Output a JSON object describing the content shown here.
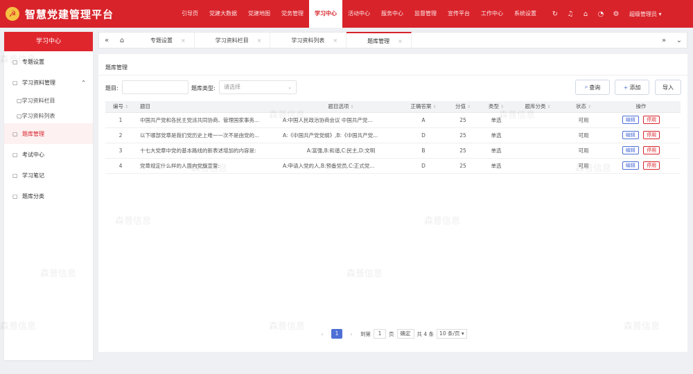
{
  "header": {
    "logo_glyph": "☭",
    "title": "智慧党建管理平台",
    "nav": [
      "引导页",
      "党建大数据",
      "党建地图",
      "党务管理",
      "学习中心",
      "活动中心",
      "服务中心",
      "监督管理",
      "宣传平台",
      "工作中心",
      "系统设置"
    ],
    "active_nav": "学习中心",
    "user": "超级管理员",
    "icons": [
      "refresh-icon",
      "bell-icon",
      "home-icon",
      "lock-icon",
      "settings-icon"
    ]
  },
  "sidebar": {
    "title": "学习中心",
    "items": [
      {
        "label": "专题设置"
      },
      {
        "label": "学习资料管理"
      },
      {
        "label": "学习资料栏目"
      },
      {
        "label": "学习资料列表"
      },
      {
        "label": "题库管理"
      },
      {
        "label": "考试中心"
      },
      {
        "label": "学习笔记"
      },
      {
        "label": "题库分类"
      }
    ]
  },
  "tabs": [
    {
      "label": "专题设置"
    },
    {
      "label": "学习资料栏目"
    },
    {
      "label": "学习资料列表"
    },
    {
      "label": "题库管理"
    }
  ],
  "panel": {
    "page_title": "题库管理",
    "filter": {
      "title_label": "题目:",
      "type_label": "题库类型:",
      "type_placeholder": "请选择"
    },
    "buttons": {
      "search": "查询",
      "add": "添加",
      "import": "导入"
    }
  },
  "table": {
    "columns": [
      "编号",
      "题目",
      "题目选项",
      "正确答案",
      "分值",
      "类型",
      "题库分类",
      "状态",
      "操作"
    ],
    "rows": [
      {
        "id": "1",
        "title": "中国共产党和各民主党派共同协商、管理国家事务...",
        "options": "A:中国人民政治协商会议 中国共产党...",
        "answer": "A",
        "score": "25",
        "type": "单选",
        "category": "",
        "status": "可用"
      },
      {
        "id": "2",
        "title": "以下哪部党章是我们党历史上唯一一次不是由党的...",
        "options": "A:《中国共产党党纲》,B:《中国共产党...",
        "answer": "D",
        "score": "25",
        "type": "单选",
        "category": "",
        "status": "可用"
      },
      {
        "id": "3",
        "title": "十七大党章中党的基本路线的新表述增加的内容是:",
        "options": "A:富强,B:和谐,C:民主,D:文明",
        "answer": "B",
        "score": "25",
        "type": "单选",
        "category": "",
        "status": "可用"
      },
      {
        "id": "4",
        "title": "党章规定什么样的人面向党旗宣誓:",
        "options": "A:申请入党的人,B:预备党员,C:正式党...",
        "answer": "D",
        "score": "25",
        "type": "单选",
        "category": "",
        "status": "可用"
      }
    ],
    "op_edit": "编辑",
    "op_delete": "停用"
  },
  "pager": {
    "current": "1",
    "goto_label": "到第",
    "goto_value": "1",
    "page_unit": "页",
    "confirm": "确定",
    "total": "共 4 条",
    "page_size": "10 条/页"
  },
  "watermark": "森普信息",
  "colors": {
    "brand": "#d8232a",
    "accent": "#4d6fd6"
  }
}
